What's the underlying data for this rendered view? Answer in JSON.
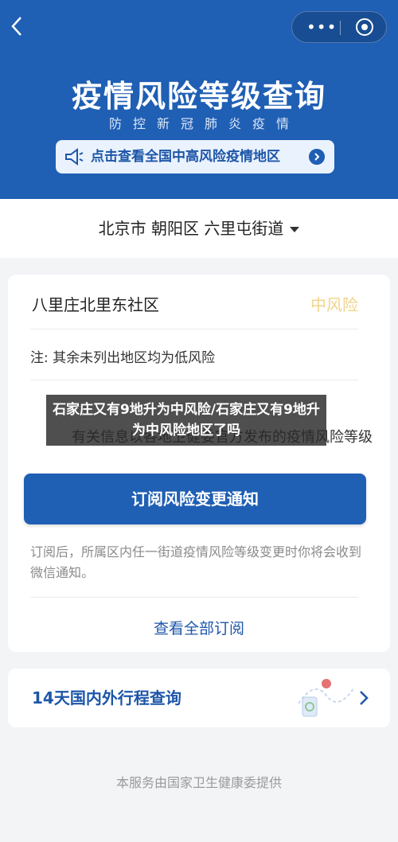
{
  "header": {
    "title": "疫情风险等级查询",
    "subtitle": "防控新冠肺炎疫情",
    "notice_text": "点击查看全国中高风险疫情地区"
  },
  "location": {
    "text": "北京市 朝阳区 六里屯街道"
  },
  "card": {
    "community": "八里庄北里东社区",
    "risk_level": "中风险",
    "note": "注: 其余未列出地区均为低风险",
    "obscured_line": "有关信息以各地卫健委官方发布的疫情风险等级",
    "subscribe_button": "订阅风险变更通知",
    "description": "订阅后，所属区内任一街道疫情风险等级变更时你将会收到微信通知。",
    "view_all": "查看全部订阅"
  },
  "trip": {
    "label": "14天国内外行程查询"
  },
  "footer": {
    "text": "本服务由国家卫生健康委提供"
  },
  "overlay": {
    "caption": "石家庄又有9地升为中风险/石家庄又有9地升为中风险地区了吗"
  },
  "colors": {
    "brand_blue": "#1f5fb4",
    "risk_yellow": "#f0d48a",
    "link_blue": "#1d56a8"
  }
}
